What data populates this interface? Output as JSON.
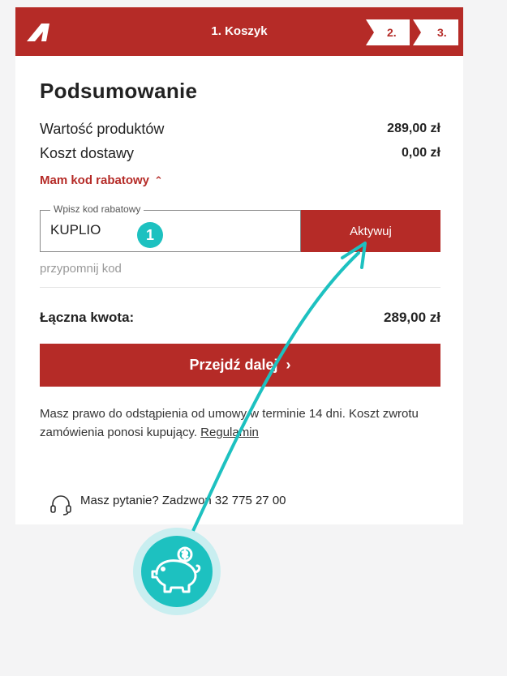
{
  "header": {
    "current_step": "1. Koszyk",
    "step2": "2.",
    "step3": "3."
  },
  "summary": {
    "title": "Podsumowanie",
    "products_label": "Wartość produktów",
    "products_value": "289,00 zł",
    "shipping_label": "Koszt dostawy",
    "shipping_value": "0,00 zł"
  },
  "promo": {
    "toggle_label": "Mam kod rabatowy",
    "field_label": "Wpisz kod rabatowy",
    "field_value": "KUPLIO",
    "activate_label": "Aktywuj",
    "remind_label": "przypomnij kod"
  },
  "total": {
    "label": "Łączna kwota:",
    "value": "289,00 zł"
  },
  "cta": {
    "label": "Przejdź dalej"
  },
  "note": {
    "text": "Masz prawo do odstąpienia od umowy w terminie 14 dni. Koszt zwrotu zamówienia ponosi kupujący.",
    "link": "Regulamin"
  },
  "help": {
    "text": "Masz pytanie? Zadzwoń",
    "phone": "32 775 27 00"
  },
  "annotation": {
    "step_number": "1"
  },
  "colors": {
    "brand": "#b52b27",
    "accent": "#1dc1c0"
  }
}
